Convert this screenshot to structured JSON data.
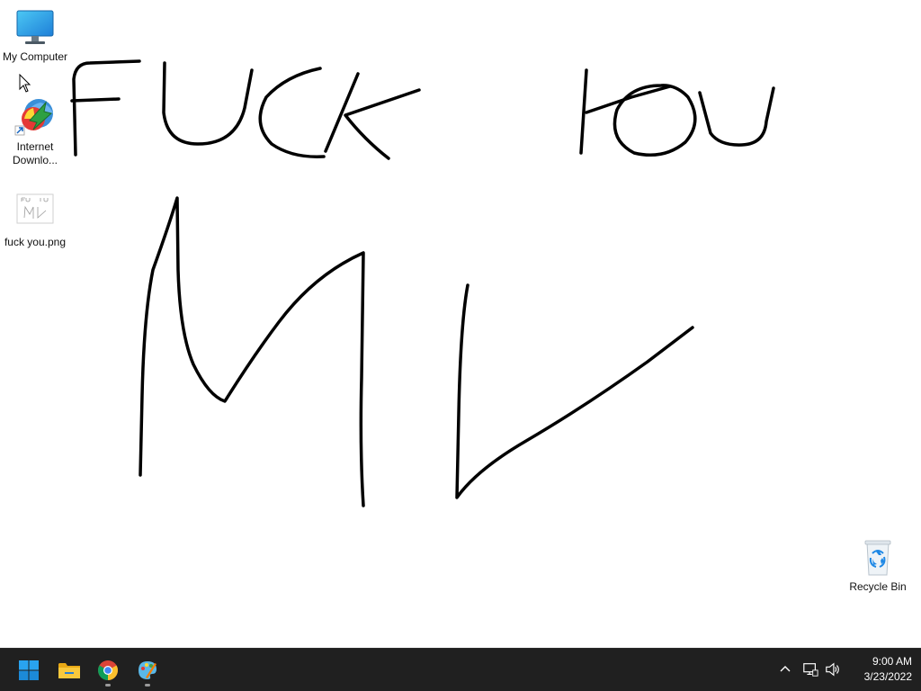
{
  "desktop": {
    "icons": [
      {
        "label": "My Computer",
        "icon": "monitor-icon"
      },
      {
        "label": "Internet Downlo...",
        "icon": "internet-download-manager-icon"
      },
      {
        "label": "fuck you.png",
        "icon": "png-image-thumbnail-icon"
      },
      {
        "label": "Recycle Bin",
        "icon": "recycle-bin-icon"
      }
    ],
    "wallpaper_icon": "handwritten-scribble-drawing"
  },
  "taskbar": {
    "buttons": [
      {
        "name": "start",
        "icon": "windows-start-icon"
      },
      {
        "name": "file-explorer",
        "icon": "folder-icon"
      },
      {
        "name": "chrome",
        "icon": "chrome-icon"
      },
      {
        "name": "paint",
        "icon": "paint-palette-icon"
      }
    ],
    "tray": {
      "chevron_icon": "chevron-up-icon",
      "network_icon": "network-icon",
      "volume_icon": "speaker-icon"
    },
    "clock": {
      "time": "9:00 AM",
      "date": "3/23/2022"
    }
  },
  "colors": {
    "taskbar_bg": "#202020",
    "desktop_bg": "#ffffff",
    "start_blue": "#1f9fe8",
    "folder_yellow": "#f7c325",
    "ink": "#000000"
  }
}
